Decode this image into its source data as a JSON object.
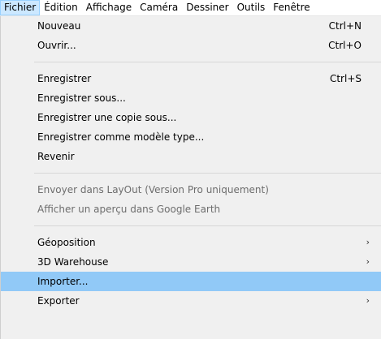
{
  "menubar": {
    "items": [
      "Fichier",
      "Édition",
      "Affichage",
      "Caméra",
      "Dessiner",
      "Outils",
      "Fenêtre"
    ]
  },
  "menu": {
    "items": [
      {
        "label": "Nouveau",
        "shortcut": "Ctrl+N"
      },
      {
        "label": "Ouvrir...",
        "shortcut": "Ctrl+O"
      },
      {
        "label": "Enregistrer",
        "shortcut": "Ctrl+S"
      },
      {
        "label": "Enregistrer sous..."
      },
      {
        "label": "Enregistrer une copie sous..."
      },
      {
        "label": "Enregistrer comme modèle type..."
      },
      {
        "label": "Revenir"
      },
      {
        "label": "Envoyer dans LayOut (Version Pro uniquement)",
        "disabled": true
      },
      {
        "label": "Afficher un aperçu dans Google Earth",
        "disabled": true
      },
      {
        "label": "Géoposition",
        "submenu": true
      },
      {
        "label": "3D Warehouse",
        "submenu": true
      },
      {
        "label": "Importer...",
        "highlighted": true
      },
      {
        "label": "Exporter",
        "submenu": true
      }
    ],
    "submenu_arrow": "›"
  },
  "colors": {
    "menubar_active_bg": "#cce8ff",
    "highlight_bg": "#91c9f7",
    "disabled_text": "#6d6d6d"
  }
}
